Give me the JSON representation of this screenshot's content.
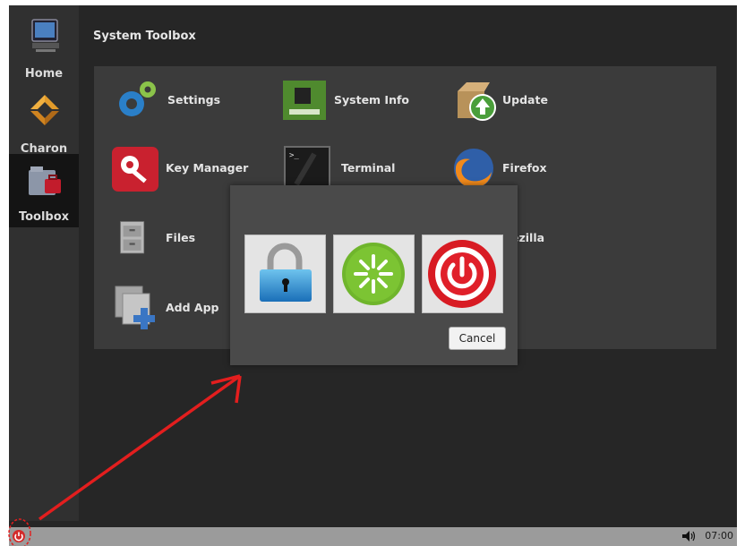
{
  "colors": {
    "desktop_bg": "#262626",
    "sidebar_bg": "#303030",
    "panel_bg": "#3b3b3b",
    "dialog_bg": "#4a4a4a",
    "taskbar_bg": "#9b9b9b",
    "annotation_red": "#e31e1e"
  },
  "sidebar": {
    "items": [
      {
        "label": "Home",
        "icon": "computer-icon"
      },
      {
        "label": "Charon",
        "icon": "charon-logo-icon"
      },
      {
        "label": "Toolbox",
        "icon": "toolbox-icon",
        "selected": true
      }
    ]
  },
  "main": {
    "title": "System Toolbox",
    "apps": [
      {
        "label": "Settings",
        "icon": "gears-icon"
      },
      {
        "label": "System Info",
        "icon": "circuit-board-icon"
      },
      {
        "label": "Update",
        "icon": "update-box-icon"
      },
      {
        "label": "Key Manager",
        "icon": "key-icon"
      },
      {
        "label": "Terminal",
        "icon": "terminal-icon"
      },
      {
        "label": "Firefox",
        "icon": "firefox-icon"
      },
      {
        "label": "Files",
        "icon": "file-cabinet-icon"
      },
      {
        "label": "ezilla",
        "icon": "filezilla-icon"
      },
      {
        "label": "Add App",
        "icon": "add-app-icon"
      }
    ]
  },
  "dialog": {
    "buttons": [
      {
        "name": "lock",
        "icon": "lock-icon"
      },
      {
        "name": "restart",
        "icon": "restart-icon"
      },
      {
        "name": "shutdown",
        "icon": "power-icon"
      }
    ],
    "cancel_label": "Cancel"
  },
  "taskbar": {
    "clock": "07:00"
  }
}
